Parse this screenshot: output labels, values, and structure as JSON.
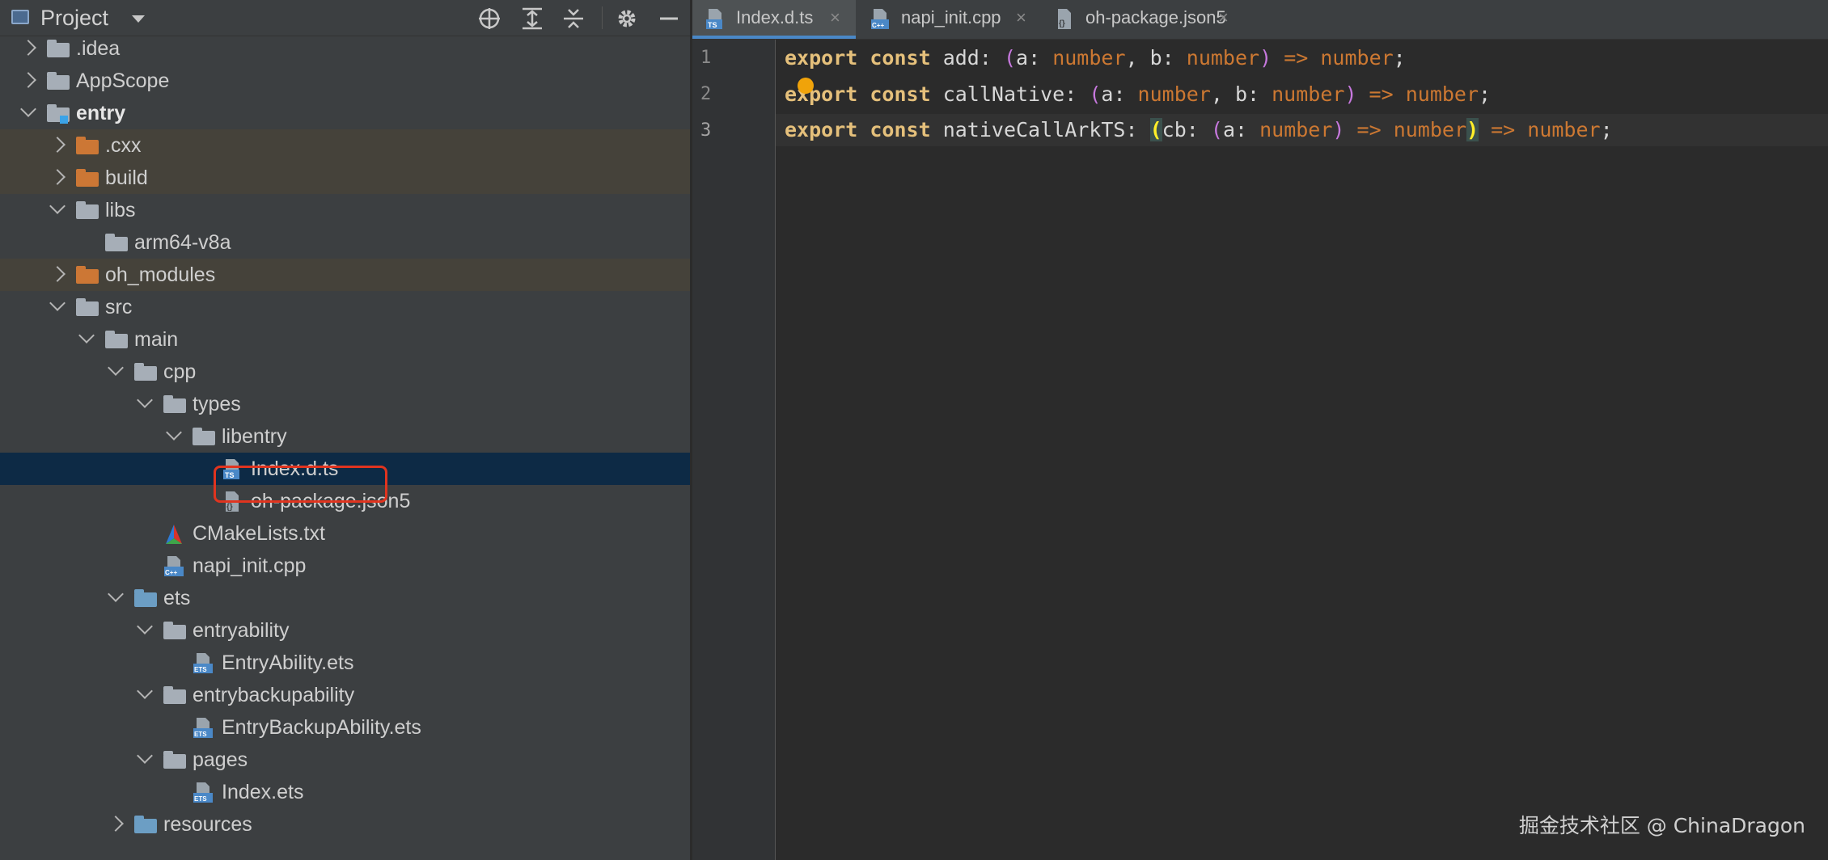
{
  "project_panel": {
    "title": "Project",
    "toolbar_icons": [
      "target-icon",
      "expand-all-icon",
      "collapse-all-icon",
      "gear-icon",
      "minimize-icon"
    ],
    "tree": [
      {
        "label": ".idea",
        "kind": "folder",
        "color": "grey",
        "state": "closed"
      },
      {
        "label": "AppScope",
        "kind": "folder",
        "color": "grey",
        "state": "closed"
      },
      {
        "label": "entry",
        "kind": "module",
        "color": "grey",
        "state": "open"
      },
      {
        "label": ".cxx",
        "kind": "folder",
        "color": "orange",
        "state": "closed"
      },
      {
        "label": "build",
        "kind": "folder",
        "color": "orange",
        "state": "closed"
      },
      {
        "label": "libs",
        "kind": "folder",
        "color": "grey",
        "state": "open"
      },
      {
        "label": "arm64-v8a",
        "kind": "folder",
        "color": "grey",
        "state": "none"
      },
      {
        "label": "oh_modules",
        "kind": "folder",
        "color": "orange",
        "state": "closed"
      },
      {
        "label": "src",
        "kind": "folder",
        "color": "grey",
        "state": "open"
      },
      {
        "label": "main",
        "kind": "folder",
        "color": "grey",
        "state": "open"
      },
      {
        "label": "cpp",
        "kind": "folder",
        "color": "grey",
        "state": "open"
      },
      {
        "label": "types",
        "kind": "folder",
        "color": "grey",
        "state": "open"
      },
      {
        "label": "libentry",
        "kind": "folder",
        "color": "grey",
        "state": "open"
      },
      {
        "label": "Index.d.ts",
        "kind": "ts-file",
        "state": "none"
      },
      {
        "label": "oh-package.json5",
        "kind": "json-file",
        "state": "none"
      },
      {
        "label": "CMakeLists.txt",
        "kind": "cmake-file",
        "state": "none"
      },
      {
        "label": "napi_init.cpp",
        "kind": "cpp-file",
        "state": "none"
      },
      {
        "label": "ets",
        "kind": "folder",
        "color": "blue",
        "state": "open"
      },
      {
        "label": "entryability",
        "kind": "folder",
        "color": "grey",
        "state": "open"
      },
      {
        "label": "EntryAbility.ets",
        "kind": "ets-file",
        "state": "none"
      },
      {
        "label": "entrybackupability",
        "kind": "folder",
        "color": "grey",
        "state": "open"
      },
      {
        "label": "EntryBackupAbility.ets",
        "kind": "ets-file",
        "state": "none"
      },
      {
        "label": "pages",
        "kind": "folder",
        "color": "grey",
        "state": "open"
      },
      {
        "label": "Index.ets",
        "kind": "ets-file",
        "state": "none"
      },
      {
        "label": "resources",
        "kind": "folder",
        "color": "blue",
        "state": "closed"
      }
    ],
    "selected_item": "Index.d.ts"
  },
  "editor": {
    "tabs": [
      {
        "label": "Index.d.ts",
        "icon": "ts-file-icon",
        "active": true,
        "close": "×"
      },
      {
        "label": "napi_init.cpp",
        "icon": "cpp-file-icon",
        "active": false,
        "close": "×"
      },
      {
        "label": "oh-package.json5",
        "icon": "json-file-icon",
        "active": false,
        "close": "×"
      }
    ],
    "line_numbers": [
      "1",
      "2",
      "3"
    ],
    "lines": [
      {
        "export": "export",
        "const": "const",
        "name": "add",
        "sig": [
          ": ",
          "(",
          "a: ",
          "number",
          ", b: ",
          "number",
          ")",
          " => ",
          "number",
          ";"
        ]
      },
      {
        "export": "export",
        "const": "const",
        "name": "callNative",
        "sig": [
          ": ",
          "(",
          "a: ",
          "number",
          ", b: ",
          "number",
          ")",
          " => ",
          "number",
          ";"
        ]
      },
      {
        "export": "export",
        "const": "const",
        "name": "nativeCallArkTS",
        "sig": [
          ": ",
          "(",
          "cb: ",
          "(",
          "a: ",
          "number",
          ")",
          " => ",
          "number",
          ")",
          " => ",
          "number",
          ";"
        ]
      }
    ]
  },
  "watermark": "掘金技术社区 @ ChinaDragon",
  "colors": {
    "panel_bg": "#3c3f41",
    "editor_bg": "#2b2b2b",
    "selection_bg": "#0d2a45",
    "excluded_bg": "#45423a",
    "highlight_box": "#e0341f",
    "keyword": "#e5c07b",
    "type": "#cc7832",
    "paren": "#c678dd"
  }
}
